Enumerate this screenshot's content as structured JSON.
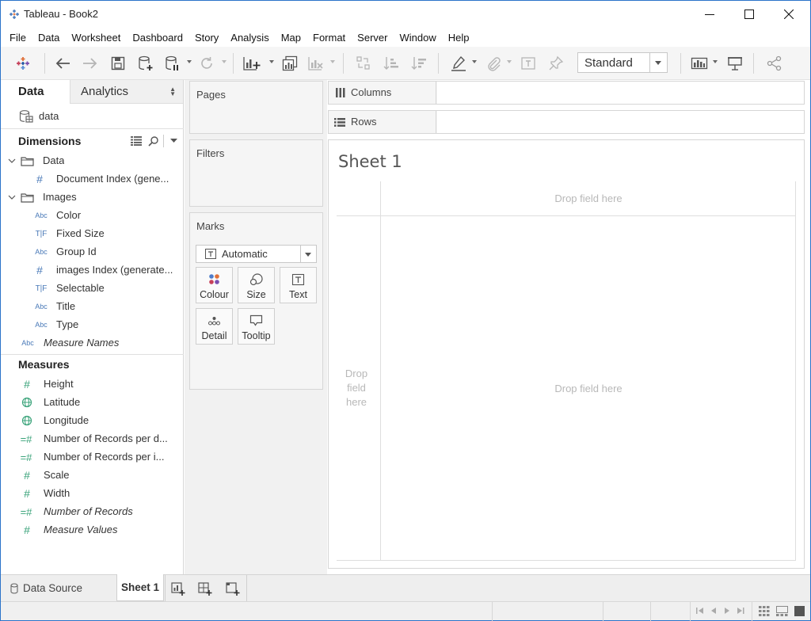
{
  "window": {
    "title": "Tableau - Book2"
  },
  "menu": [
    "File",
    "Data",
    "Worksheet",
    "Dashboard",
    "Story",
    "Analysis",
    "Map",
    "Format",
    "Server",
    "Window",
    "Help"
  ],
  "toolbar": {
    "fit_value": "Standard"
  },
  "datapane": {
    "tab_data": "Data",
    "tab_analytics": "Analytics",
    "datasource": "data",
    "dimensions_header": "Dimensions",
    "measures_header": "Measures",
    "dimensions": [
      {
        "kind": "folder",
        "label": "Data"
      },
      {
        "kind": "number",
        "label": "Document Index (gene..."
      },
      {
        "kind": "folder",
        "label": "Images"
      },
      {
        "kind": "abc",
        "label": "Color"
      },
      {
        "kind": "tf",
        "label": "Fixed Size"
      },
      {
        "kind": "abc",
        "label": "Group Id"
      },
      {
        "kind": "number",
        "label": "images Index (generate..."
      },
      {
        "kind": "tf",
        "label": "Selectable"
      },
      {
        "kind": "abc",
        "label": "Title"
      },
      {
        "kind": "abc",
        "label": "Type"
      },
      {
        "kind": "abc",
        "label": "Measure Names"
      }
    ],
    "measures": [
      {
        "kind": "number",
        "label": "Height"
      },
      {
        "kind": "globe",
        "label": "Latitude"
      },
      {
        "kind": "globe",
        "label": "Longitude"
      },
      {
        "kind": "calc",
        "label": "Number of Records per d..."
      },
      {
        "kind": "calc",
        "label": "Number of Records per i..."
      },
      {
        "kind": "number",
        "label": "Scale"
      },
      {
        "kind": "number",
        "label": "Width"
      },
      {
        "kind": "calc",
        "label": "Number of Records"
      },
      {
        "kind": "number",
        "label": "Measure Values"
      }
    ]
  },
  "cards": {
    "pages": "Pages",
    "filters": "Filters",
    "marks": "Marks",
    "mark_type": "Automatic",
    "buttons": [
      "Colour",
      "Size",
      "Text",
      "Detail",
      "Tooltip"
    ]
  },
  "shelves": {
    "columns": "Columns",
    "rows": "Rows"
  },
  "view": {
    "sheet_title": "Sheet 1",
    "drop_top": "Drop field here",
    "drop_left": "Drop field here",
    "drop_center": "Drop field here"
  },
  "bottom": {
    "data_source_tab": "Data Source",
    "sheet_tab": "Sheet 1"
  },
  "colors": {
    "accent": "#2b73c9",
    "field_blue": "#4a7ab8",
    "measure_green": "#3aa37a"
  }
}
